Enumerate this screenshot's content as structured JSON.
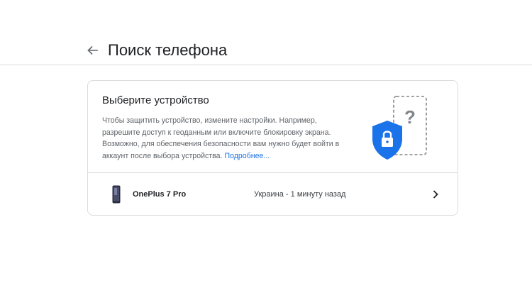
{
  "header": {
    "title": "Поиск телефона",
    "back_icon": "arrow-back-icon"
  },
  "card": {
    "title": "Выберите устройство",
    "description": "Чтобы защитить устройство, измените настройки. Например, разрешите доступ к геоданным или включите блокировку экрана. Возможно, для обеспечения безопасности вам нужно будет войти в аккаунт после выбора устройства.",
    "learn_more": "Подробнее...",
    "illustration_icon": "phone-security-illustration",
    "colors": {
      "shield": "#1a73e8",
      "link": "#1a73e8",
      "divider": "#dadce0"
    }
  },
  "devices": [
    {
      "name": "OnePlus 7 Pro",
      "status": "Украина - 1 минуту назад",
      "icon": "phone-icon"
    }
  ]
}
